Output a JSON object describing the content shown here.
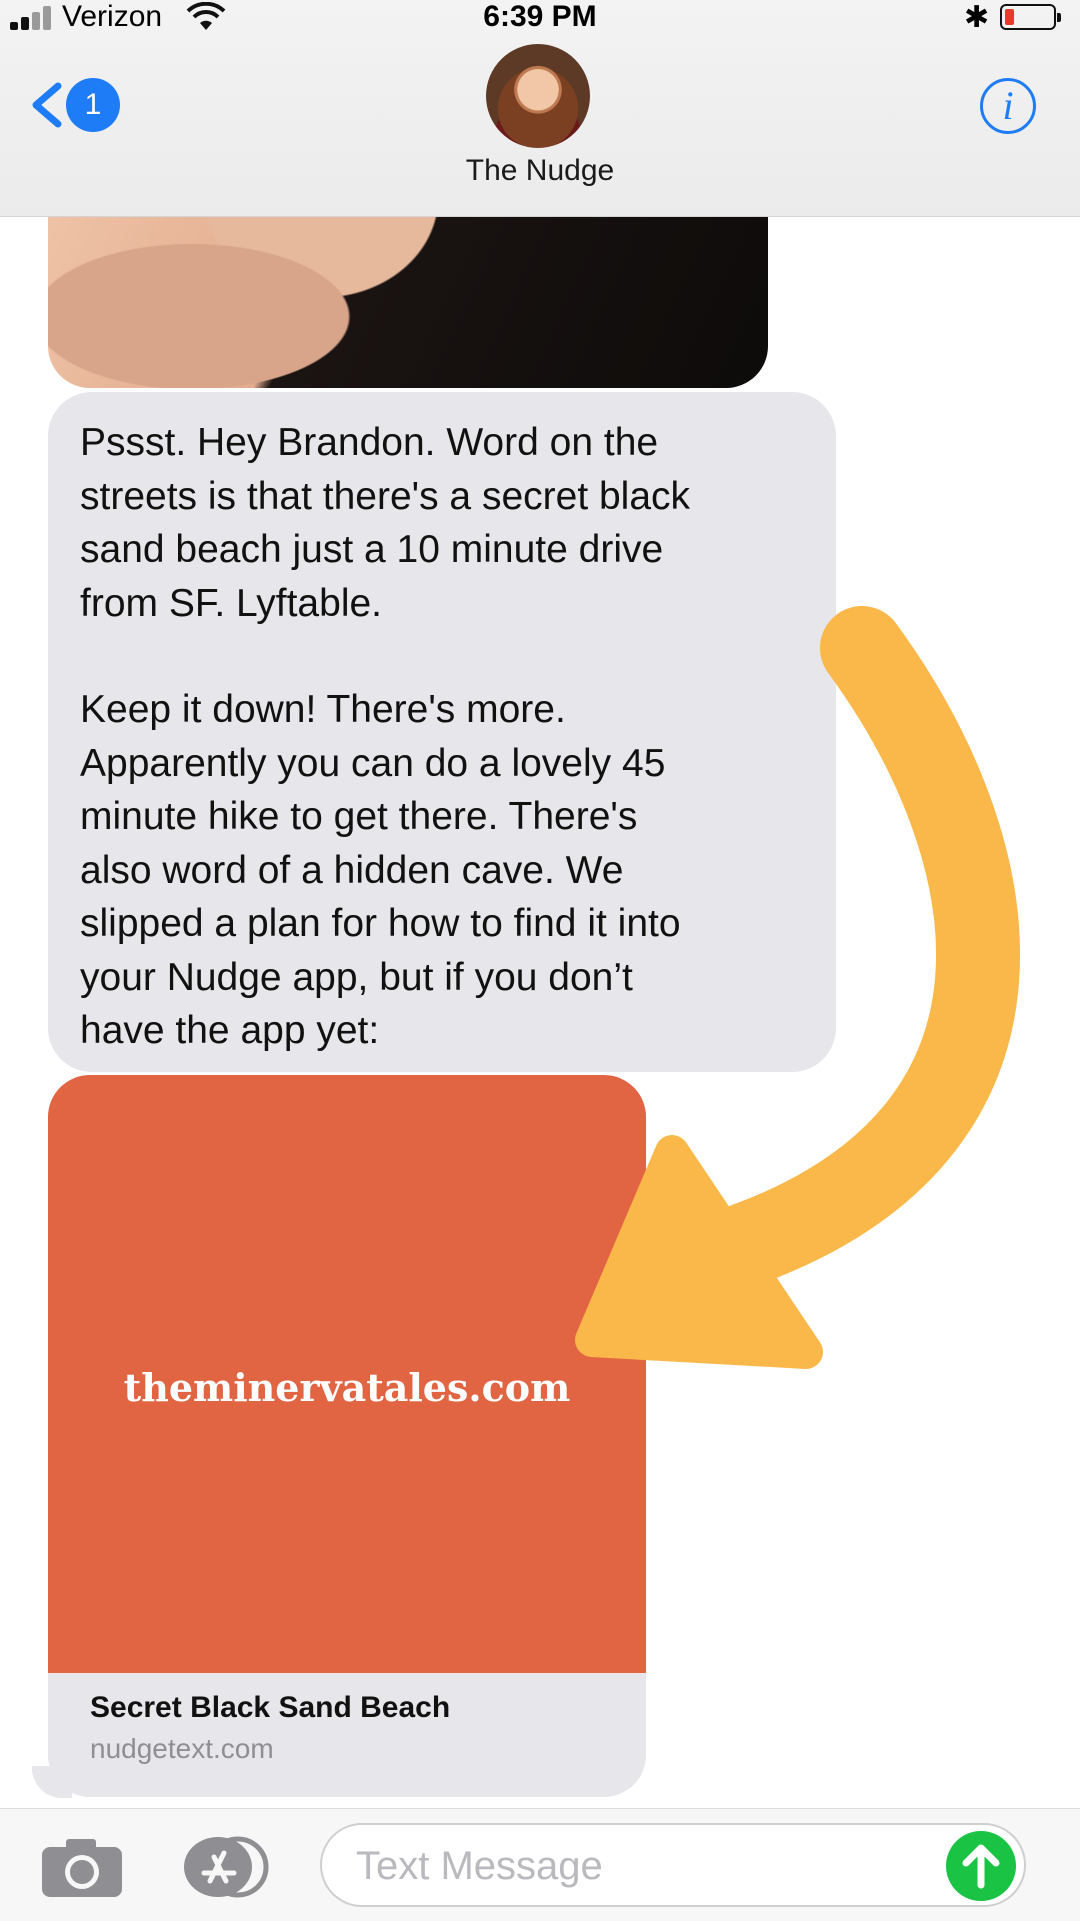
{
  "status_bar": {
    "carrier": "Verizon",
    "time": "6:39 PM",
    "bluetooth_glyph": "✱",
    "battery_level": 0.2,
    "battery_color": "#e83a2c"
  },
  "header": {
    "back_badge_count": "1",
    "contact_name": "The Nudge",
    "info_label": "i",
    "accent_color": "#1f7cf7"
  },
  "messages": {
    "text_paragraphs": [
      "Pssst. Hey Brandon. Word on the\nstreets is that there's a secret black\nsand beach just a 10 minute drive\nfrom SF. Lyftable.",
      "Keep it down! There's more.\nApparently you can do a lovely 45\nminute hike to get there. There's\nalso word of a hidden cave. We\nslipped a plan for how to find it into\nyour Nudge app, but if you don’t\nhave the app yet:"
    ],
    "link_preview": {
      "image_watermark": "theminervatales.com",
      "title": "Secret Black Sand Beach",
      "domain": "nudgetext.com",
      "image_color": "#e26543"
    }
  },
  "overlay": {
    "arrow_color": "#fbb84a"
  },
  "composer": {
    "placeholder": "Text Message",
    "send_color": "#1bc345",
    "icons": [
      "camera-icon",
      "app-store-icon",
      "send-arrow-icon"
    ]
  }
}
